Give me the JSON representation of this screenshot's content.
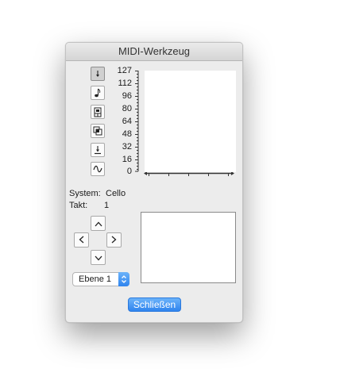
{
  "window": {
    "title": "MIDI-Werkzeug"
  },
  "toolbar": {
    "tools": [
      {
        "name": "down-arrow-icon",
        "pressed": true
      },
      {
        "name": "eighth-note-icon",
        "pressed": false
      },
      {
        "name": "organ-stop-icon",
        "pressed": false
      },
      {
        "name": "overlap-squares-icon",
        "pressed": false
      },
      {
        "name": "arrow-to-baseline-icon",
        "pressed": false
      },
      {
        "name": "sine-wave-icon",
        "pressed": false
      }
    ]
  },
  "velocity_scale": {
    "labels": [
      "127",
      "112",
      "96",
      "80",
      "64",
      "48",
      "32",
      "16",
      "0"
    ]
  },
  "info": {
    "system_label": "System:",
    "system_value": "Cello",
    "measure_label": "Takt:",
    "measure_value": "1"
  },
  "navigation": {
    "up": "chevron-up-icon",
    "left": "chevron-left-icon",
    "right": "chevron-right-icon",
    "down": "chevron-down-icon"
  },
  "layer_select": {
    "value": "Ebene 1"
  },
  "buttons": {
    "close_label": "Schließen"
  },
  "colors": {
    "accent": "#2f84ee",
    "window_bg": "#ececec"
  }
}
